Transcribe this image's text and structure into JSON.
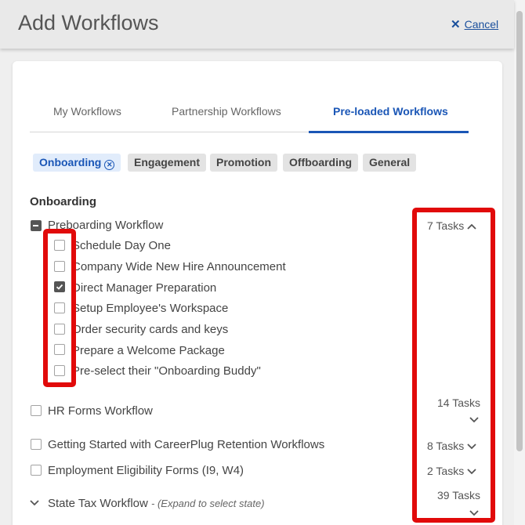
{
  "header": {
    "title": "Add Workflows",
    "cancel_label": "Cancel"
  },
  "tabs": [
    {
      "label": "My Workflows"
    },
    {
      "label": "Partnership Workflows"
    },
    {
      "label": "Pre-loaded Workflows"
    }
  ],
  "filters": [
    {
      "label": "Onboarding"
    },
    {
      "label": "Engagement"
    },
    {
      "label": "Promotion"
    },
    {
      "label": "Offboarding"
    },
    {
      "label": "General"
    }
  ],
  "section": {
    "title": "Onboarding"
  },
  "workflows": [
    {
      "name": "Preboarding Workflow",
      "count": "7 Tasks",
      "tasks": [
        "Schedule Day One",
        "Company Wide New Hire Announcement",
        "Direct Manager Preparation",
        "Setup Employee's Workspace",
        "Order security cards and keys",
        "Prepare a Welcome Package",
        "Pre-select their \"Onboarding Buddy\""
      ]
    },
    {
      "name": "HR Forms Workflow",
      "count": "14 Tasks"
    },
    {
      "name": "Getting Started with CareerPlug Retention Workflows",
      "count": "8 Tasks"
    },
    {
      "name": "Employment Eligibility Forms (I9, W4)",
      "count": "2 Tasks"
    },
    {
      "name": "State Tax Workflow",
      "hint": "- (Expand to select state)",
      "count": "39 Tasks"
    }
  ],
  "colors": {
    "accent": "#1a56b6",
    "highlight": "#e10a0a"
  }
}
